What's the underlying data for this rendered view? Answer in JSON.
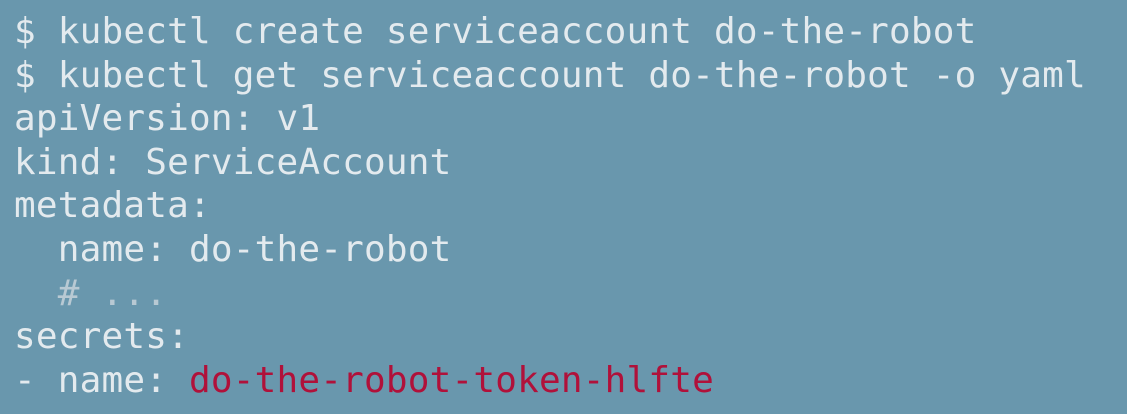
{
  "terminal": {
    "lines": [
      {
        "text": "$ kubectl create serviceaccount do-the-robot"
      },
      {
        "text": "$ kubectl get serviceaccount do-the-robot -o yaml"
      },
      {
        "text": "apiVersion: v1"
      },
      {
        "text": "kind: ServiceAccount"
      },
      {
        "text": "metadata:"
      },
      {
        "text": "  name: do-the-robot"
      },
      {
        "text": "  # ..."
      },
      {
        "text": "secrets:"
      },
      {
        "prefix": "- name: ",
        "value": "do-the-robot-token-hlfte"
      }
    ]
  },
  "colors": {
    "background": "#6997AD",
    "text": "#E3EAEE",
    "comment": "#B8C9D3",
    "highlight": "#B0113A"
  }
}
